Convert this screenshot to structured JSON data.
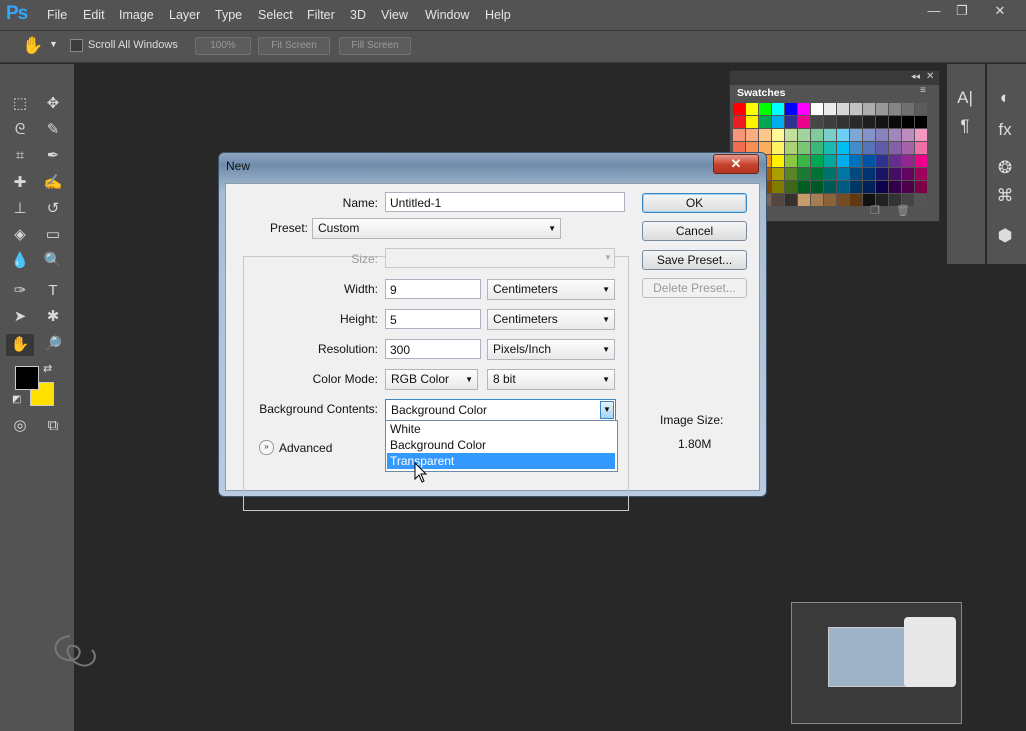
{
  "app": {
    "logo": "Ps"
  },
  "menu": [
    "File",
    "Edit",
    "Image",
    "Layer",
    "Type",
    "Select",
    "Filter",
    "3D",
    "View",
    "Window",
    "Help"
  ],
  "window_controls": {
    "minimize": "—",
    "restore": "❐",
    "close": "✕"
  },
  "options_bar": {
    "scroll_all_windows": "Scroll All Windows",
    "scroll_all_checked": false,
    "zoom_100": "100%",
    "fit_screen": "Fit Screen",
    "fill_screen": "Fill Screen"
  },
  "swatches": {
    "title": "Swatches",
    "rows": [
      [
        "#ff0000",
        "#ffff00",
        "#00ff00",
        "#00ffff",
        "#0000ff",
        "#ff00ff",
        "#ffffff",
        "#ebebeb",
        "#d6d6d6",
        "#c2c2c2",
        "#adadad",
        "#999999",
        "#858585",
        "#707070",
        "#5c5c5c"
      ],
      [
        "#ed1c24",
        "#fff200",
        "#00a651",
        "#00aeef",
        "#2e3192",
        "#ec008c",
        "#474747",
        "#3d3d3d",
        "#333333",
        "#292929",
        "#1f1f1f",
        "#141414",
        "#0a0a0a",
        "#000000",
        "#000000"
      ],
      [
        "#f7977a",
        "#f9ad81",
        "#fdc68a",
        "#fff79a",
        "#c4df9b",
        "#a2d39c",
        "#82ca9d",
        "#7bcdc8",
        "#6ecff6",
        "#7ea7d8",
        "#8493ca",
        "#8882be",
        "#a187be",
        "#bc8dbf",
        "#f49ac2"
      ],
      [
        "#f26c4f",
        "#f68e55",
        "#fbaf5c",
        "#fff467",
        "#acd372",
        "#7cc576",
        "#3bb878",
        "#1abbb4",
        "#00bff3",
        "#438ccb",
        "#5574b9",
        "#605ca8",
        "#855fa8",
        "#a763a8",
        "#f06ea9"
      ],
      [
        "#ed1c24",
        "#f26522",
        "#f7941d",
        "#fff200",
        "#8dc63f",
        "#39b54a",
        "#00a651",
        "#00a99d",
        "#00aeef",
        "#0072bc",
        "#0054a6",
        "#2e3192",
        "#662d91",
        "#92278f",
        "#ec008c"
      ],
      [
        "#9e0b0f",
        "#a0410d",
        "#a3620a",
        "#aba000",
        "#598527",
        "#1a7b30",
        "#007236",
        "#00746b",
        "#0076a3",
        "#004a80",
        "#003471",
        "#1b1464",
        "#440e62",
        "#630460",
        "#9e005d"
      ],
      [
        "#790000",
        "#7b2e00",
        "#7d4900",
        "#827b00",
        "#406618",
        "#005e20",
        "#005826",
        "#005952",
        "#005b7f",
        "#003663",
        "#002157",
        "#0d004c",
        "#32004b",
        "#4b0049",
        "#7b0046"
      ],
      [
        "#c7b299",
        "#998675",
        "#736357",
        "#534741",
        "#37302d",
        "#c69c6d",
        "#a67c52",
        "#8c6239",
        "#754c24",
        "#603913",
        "#111111",
        "#222222",
        "#333333",
        "#444444",
        "#555555"
      ]
    ]
  },
  "dialog": {
    "title": "New",
    "close": "✕",
    "name_label": "Name:",
    "name_value": "Untitled-1",
    "preset_label": "Preset:",
    "preset_value": "Custom",
    "size_label": "Size:",
    "size_value": "",
    "width_label": "Width:",
    "width_value": "9",
    "width_unit": "Centimeters",
    "height_label": "Height:",
    "height_value": "5",
    "height_unit": "Centimeters",
    "resolution_label": "Resolution:",
    "resolution_value": "300",
    "resolution_unit": "Pixels/Inch",
    "color_mode_label": "Color Mode:",
    "color_mode_value": "RGB Color",
    "bit_depth_value": "8 bit",
    "bg_contents_label": "Background Contents:",
    "bg_contents_value": "Background Color",
    "bg_options": [
      "White",
      "Background Color",
      "Transparent"
    ],
    "bg_highlighted": "Transparent",
    "advanced_label": "Advanced",
    "ok": "OK",
    "cancel": "Cancel",
    "save_preset": "Save Preset...",
    "delete_preset": "Delete Preset...",
    "image_size_label": "Image Size:",
    "image_size_value": "1.80M"
  },
  "colors": {
    "foreground": "#000000",
    "background": "#ffe000",
    "accent": "#3399ff"
  }
}
